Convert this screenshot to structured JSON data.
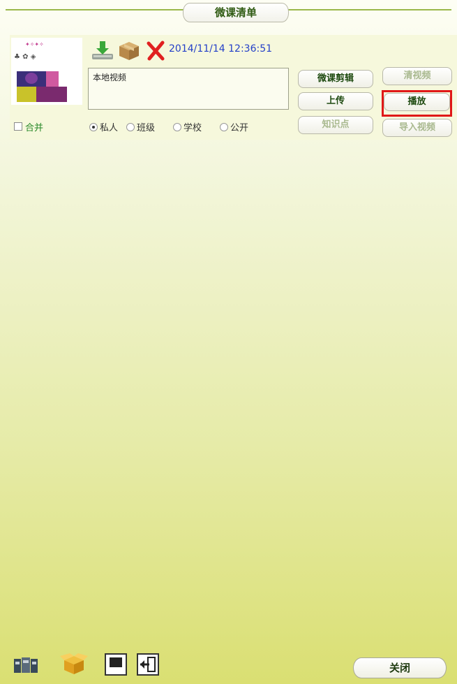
{
  "header": {
    "title": "微课清单"
  },
  "item": {
    "thumbnail_alt": "微课封面",
    "date": "2014/11/14 12:36:51",
    "description": "本地视频",
    "merge_label": "合并",
    "visibility": {
      "options": [
        "私人",
        "班级",
        "学校",
        "公开"
      ],
      "selected": "私人"
    }
  },
  "buttons": {
    "edit": "微课剪辑",
    "clear_video": "清视频",
    "upload": "上传",
    "play": "播放",
    "knowledge": "知识点",
    "import_video": "导入视频"
  },
  "footer": {
    "close": "关闭"
  },
  "colors": {
    "highlight": "#e01818",
    "accent": "#9ab84a"
  }
}
